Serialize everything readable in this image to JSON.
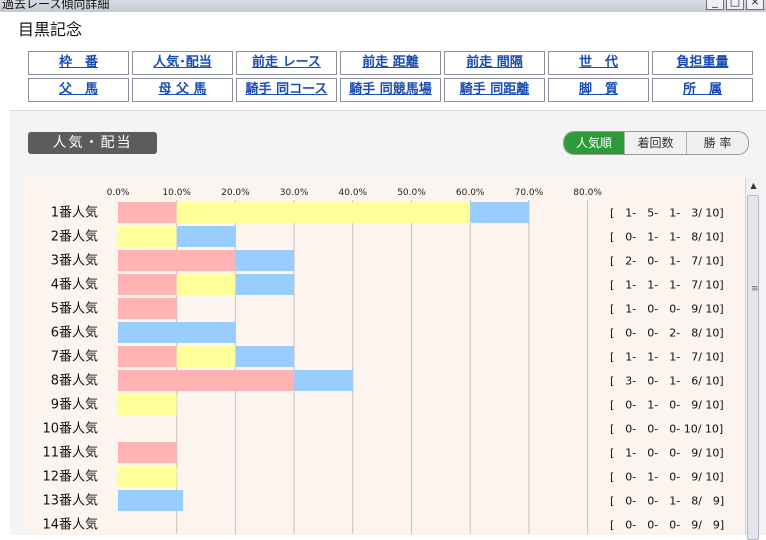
{
  "window": {
    "title": "過去レース傾向詳細",
    "buttons": {
      "minimize": "_",
      "maximize": "□",
      "close": "×"
    }
  },
  "race_title": "目黒記念",
  "nav": {
    "row1": [
      "枠　番",
      "人気･配当",
      "前走 レース",
      "前走 距離",
      "前走 間隔",
      "世　代",
      "負担重量"
    ],
    "row2": [
      "父　馬",
      "母 父 馬",
      "騎手 同コース",
      "騎手 同競馬場",
      "騎手 同距離",
      "脚　質",
      "所　属"
    ]
  },
  "section": {
    "label": "人気・配当"
  },
  "sort_toggle": {
    "active": "人気順",
    "options": [
      "人気順",
      "着回数",
      "勝 率"
    ]
  },
  "colors": {
    "win": "#ffb3b3",
    "second": "#ffff99",
    "third": "#99ccff",
    "toggle_active": "#2f9a3a"
  },
  "chart_data": {
    "type": "bar",
    "stacked": true,
    "orientation": "horizontal",
    "xlim": [
      0,
      80
    ],
    "xticks": [
      "0.0%",
      "10.0%",
      "20.0%",
      "30.0%",
      "40.0%",
      "50.0%",
      "60.0%",
      "70.0%",
      "80.0%"
    ],
    "categories": [
      "1番人気",
      "2番人気",
      "3番人気",
      "4番人気",
      "5番人気",
      "6番人気",
      "7番人気",
      "8番人気",
      "9番人気",
      "10番人気",
      "11番人気",
      "12番人気",
      "13番人気",
      "14番人気"
    ],
    "series": [
      {
        "values": [
          10,
          0,
          20,
          10,
          10,
          0,
          10,
          30,
          0,
          0,
          10,
          0,
          0,
          0
        ]
      },
      {
        "values": [
          50,
          10,
          0,
          10,
          0,
          0,
          10,
          0,
          10,
          0,
          0,
          10,
          0,
          0
        ]
      },
      {
        "values": [
          10,
          10,
          10,
          10,
          0,
          20,
          10,
          10,
          0,
          0,
          0,
          0,
          11.1,
          0
        ]
      }
    ],
    "records": [
      "[　1-　5-　1-　3/ 10]",
      "[　0-　1-　1-　8/ 10]",
      "[　2-　0-　1-　7/ 10]",
      "[　1-　1-　1-　7/ 10]",
      "[　1-　0-　0-　9/ 10]",
      "[　0-　0-　2-　8/ 10]",
      "[　1-　1-　1-　7/ 10]",
      "[　3-　0-　1-　6/ 10]",
      "[　0-　1-　0-　9/ 10]",
      "[　0-　0-　0- 10/ 10]",
      "[　1-　0-　0-　9/ 10]",
      "[　0-　1-　0-　9/ 10]",
      "[　0-　0-　1-　8/　9]",
      "[　0-　0-　0-　9/　9]"
    ]
  }
}
